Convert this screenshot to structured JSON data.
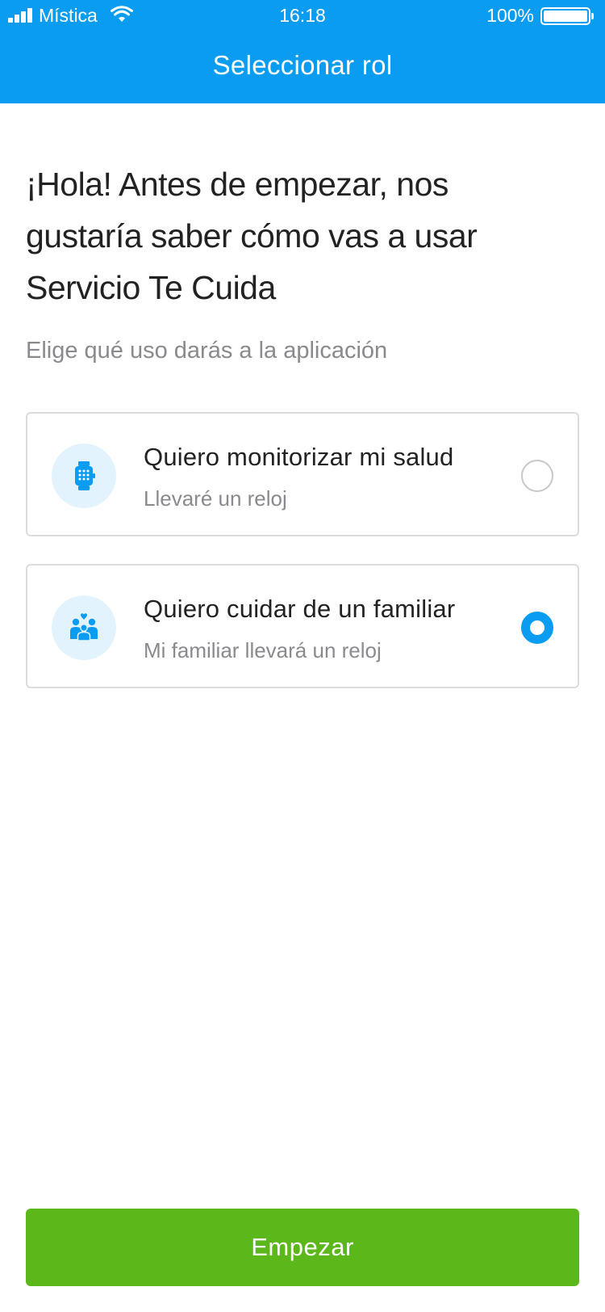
{
  "status_bar": {
    "carrier": "Mística",
    "time": "16:18",
    "battery_percent": "100%"
  },
  "header": {
    "title": "Seleccionar rol"
  },
  "intro": {
    "line1": "¡Hola! Antes de empezar, nos",
    "line2": "gustaría saber cómo vas a usar",
    "line3": "Servicio Te Cuida"
  },
  "subtitle": "Elige qué uso darás a la aplicación",
  "options": [
    {
      "title": "Quiero monitorizar mi salud",
      "subtitle": "Llevaré un reloj",
      "icon": "smartwatch-icon",
      "selected": false
    },
    {
      "title": "Quiero cuidar de un familiar",
      "subtitle": "Mi familiar llevará un reloj",
      "icon": "family-icon",
      "selected": true
    }
  ],
  "button": {
    "label": "Empezar"
  },
  "colors": {
    "header_blue": "#0a9cf0",
    "button_green": "#5cb71a",
    "icon_bg": "#e3f3fd",
    "secondary_text": "#8a8a8e"
  }
}
